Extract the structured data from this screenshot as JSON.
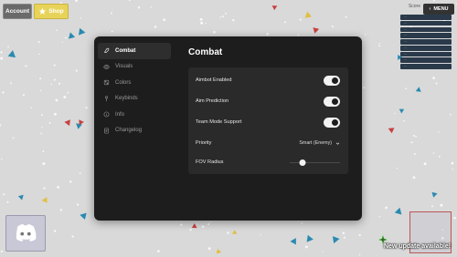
{
  "header": {
    "account_label": "Account",
    "shop_label": "Shop",
    "score_label": "Score",
    "menu_label": "MENU"
  },
  "leaderboard": {
    "rows": [
      "…",
      "…",
      "…",
      "…",
      "…",
      "…",
      "…",
      "…",
      "…"
    ]
  },
  "sidebar": {
    "items": [
      {
        "label": "Combat",
        "icon": "sword-icon",
        "active": true
      },
      {
        "label": "Visuals",
        "icon": "eye-icon",
        "active": false
      },
      {
        "label": "Colors",
        "icon": "palette-icon",
        "active": false
      },
      {
        "label": "Keybinds",
        "icon": "keyboard-icon",
        "active": false
      },
      {
        "label": "Info",
        "icon": "info-icon",
        "active": false
      },
      {
        "label": "Changelog",
        "icon": "document-icon",
        "active": false
      }
    ]
  },
  "main": {
    "title": "Combat",
    "settings": [
      {
        "label": "Aimbot Enabled",
        "type": "toggle",
        "value": true
      },
      {
        "label": "Aim Prediction",
        "type": "toggle",
        "value": true
      },
      {
        "label": "Team Mode Support",
        "type": "toggle",
        "value": true
      },
      {
        "label": "Priority",
        "type": "select",
        "value": "Smart (Enemy)"
      },
      {
        "label": "FOV Radius",
        "type": "slider",
        "value": 0.25
      }
    ]
  },
  "footer": {
    "update_notice": "New update available!"
  },
  "colors": {
    "modal_bg": "#1d1d1d",
    "panel_bg": "#2a2a2a",
    "shop_yellow": "#e8d35a",
    "accent_white": "#f2f2f2"
  }
}
